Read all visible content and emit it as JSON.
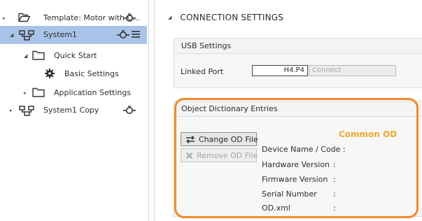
{
  "tree": {
    "items": [
      {
        "label": "Template: Motor with C...",
        "icon": "folder-open-icon",
        "action_icon": "connection-icon"
      },
      {
        "label": "System1",
        "icon": "system-network-icon",
        "action_icon": "connection-icon",
        "menu_icon": "menu-icon",
        "selected": true
      },
      {
        "label": "Quick Start",
        "icon": "folder-icon"
      },
      {
        "label": "Basic Settings",
        "icon": "gear-icon"
      },
      {
        "label": "Application Settings",
        "icon": "folder-icon"
      },
      {
        "label": "System1 Copy",
        "icon": "system-network-icon",
        "action_icon": "connection-icon"
      }
    ],
    "selected_color": "#a9c4e8"
  },
  "main": {
    "section_title": "CONNECTION SETTINGS",
    "usb": {
      "title": "USB Settings",
      "linked_port_label": "Linked Port",
      "linked_port_value": "H4.P4",
      "connect_label": "Connect"
    },
    "od": {
      "title": "Object Dictionary Entries",
      "change_label": "Change OD File",
      "remove_label": "Remove OD File",
      "heading": "Common OD",
      "heading_color": "#f0a830",
      "fields": [
        {
          "label": "Device Name / Code :",
          "value": ""
        },
        {
          "label": "Hardware Version",
          "value": ":"
        },
        {
          "label": "Firmware Version",
          "value": ":"
        },
        {
          "label": "Serial Number",
          "value": ":"
        },
        {
          "label": "OD.xml",
          "value": ":"
        }
      ]
    },
    "highlight_color": "#f08a2c"
  }
}
